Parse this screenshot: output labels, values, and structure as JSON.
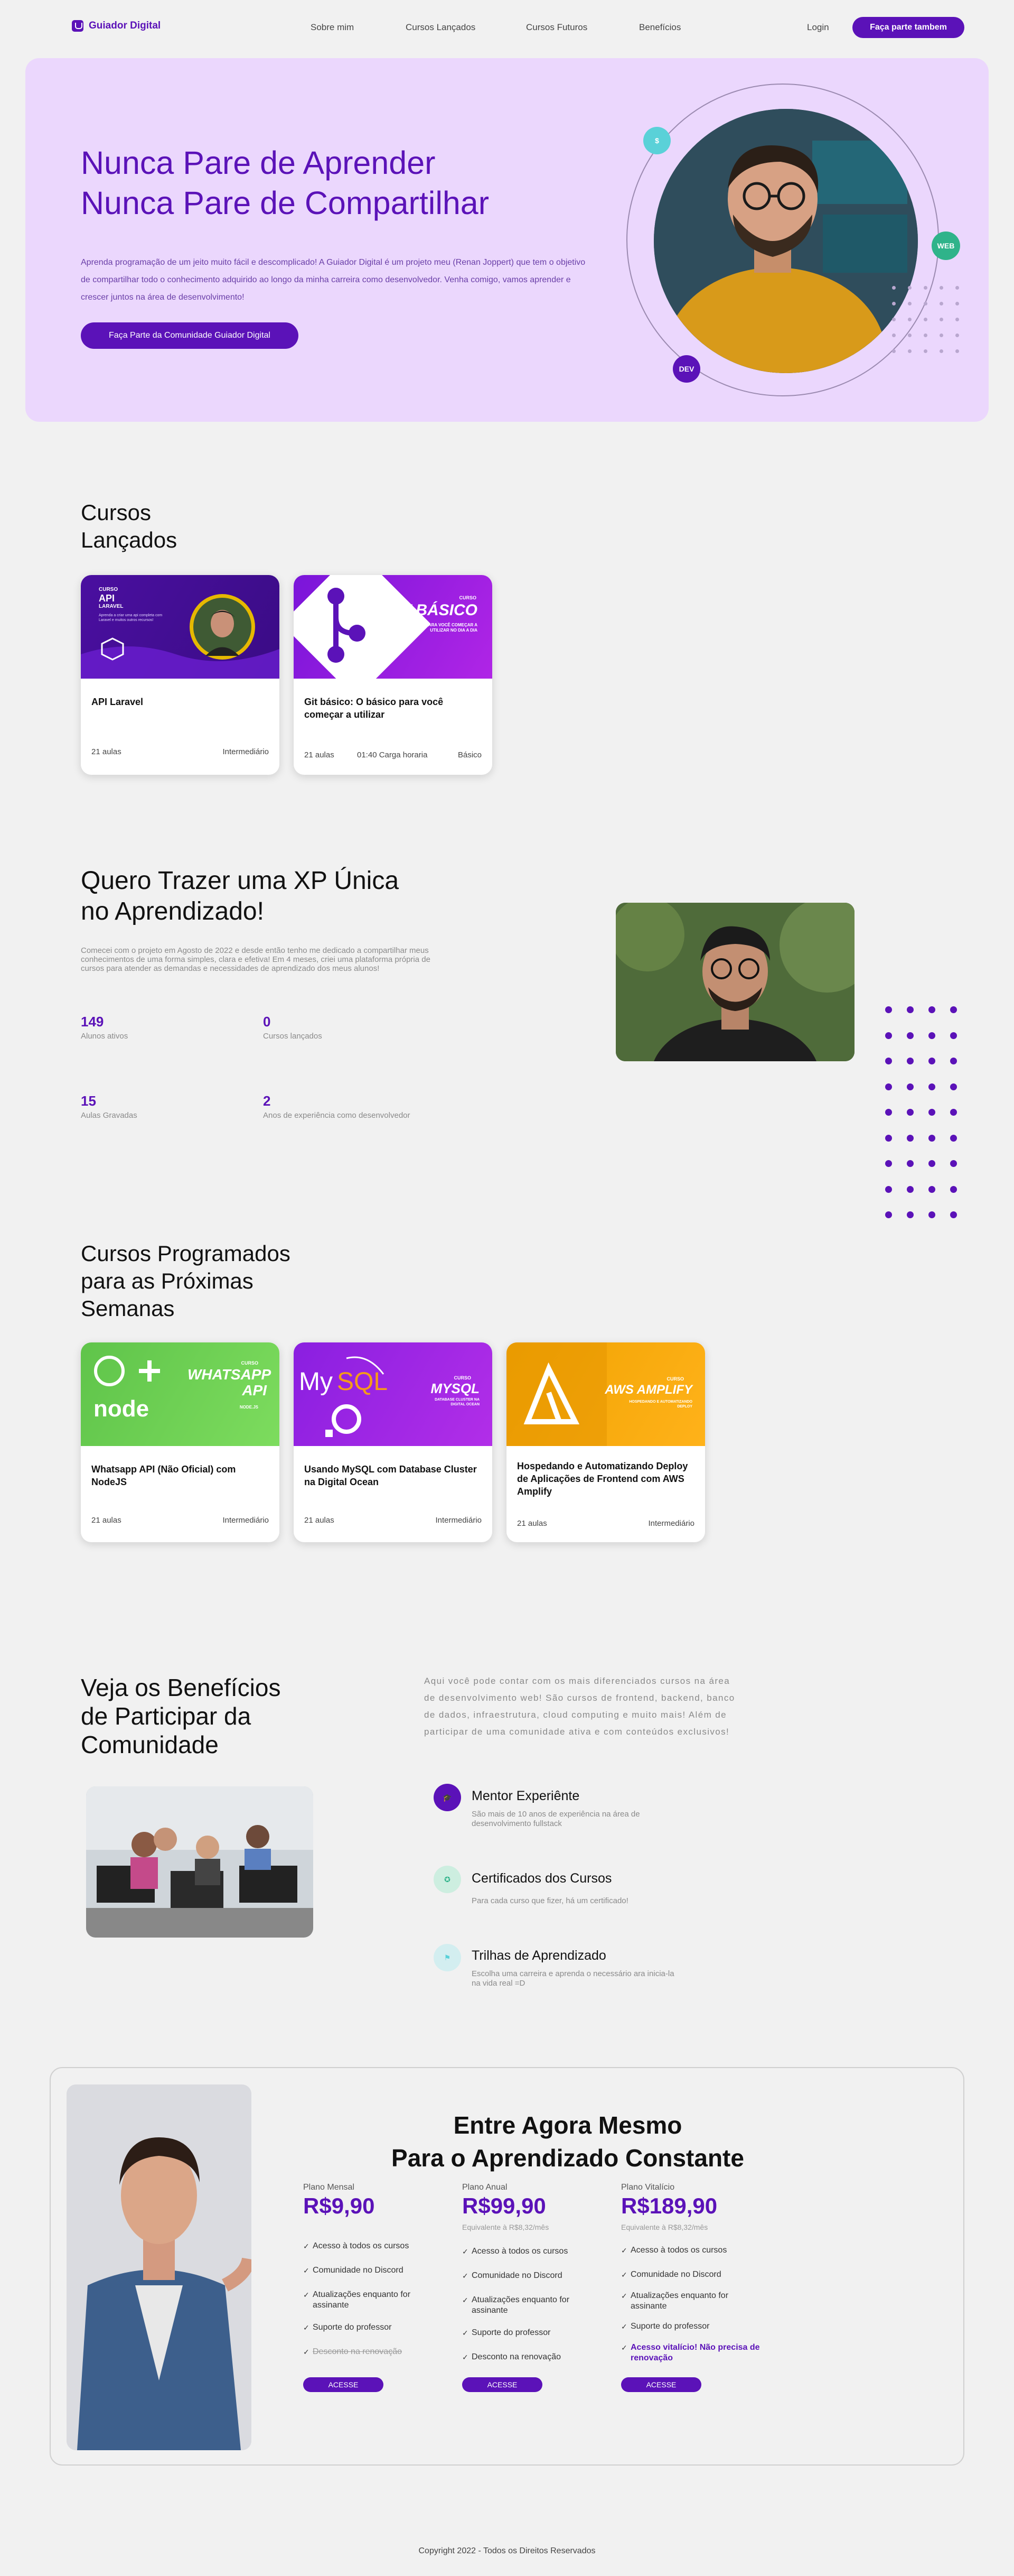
{
  "colors": {
    "brand": "#5b12b8",
    "hero_bg": "#ebd7fd",
    "teal": "#5ad1d8",
    "green": "#2fb38a",
    "light_bg": "#f1f1f1"
  },
  "nav": {
    "logo": "Guiador Digital",
    "links": [
      "Sobre mim",
      "Cursos Lançados",
      "Cursos Futuros",
      "Benefícios"
    ],
    "login": "Login",
    "cta": "Faça parte tambem"
  },
  "hero": {
    "title_line1": "Nunca Pare de Aprender",
    "title_line2": "Nunca Pare de Compartilhar",
    "text": "Aprenda programação de um jeito muito fácil e descomplicado! A Guiador Digital é um projeto meu (Renan Joppert) que tem o objetivo de compartilhar todo o conhecimento adquirido ao longo da minha carreira como desenvolvedor. Venha comigo, vamos aprender e crescer juntos na área de desenvolvimento!",
    "button": "Faça Parte da Comunidade Guiador Digital",
    "badges": [
      "$",
      "WEB",
      "DEV"
    ]
  },
  "launched": {
    "title_line1": "Cursos",
    "title_line2": "Lançados",
    "cards": [
      {
        "title": "API Laravel",
        "lessons": "21 aulas",
        "hours": "",
        "level": "Intermediário",
        "img_label_small": "CURSO",
        "img_label": "API",
        "img_label2": "LARAVEL",
        "img_caption": "Aprenda a criar uma api completa com Laravel e muitos outros recursos!"
      },
      {
        "title": "Git básico: O básico para você começar a utilizar",
        "lessons": "21 aulas",
        "hours": "01:40 Carga horaria",
        "level": "Básico",
        "img_label_small": "CURSO",
        "img_label": "GIT BÁSICO",
        "img_caption": "O BÁSICO PARA VOCÊ COMEÇAR A UTILIZAR NO DIA A DIA"
      }
    ]
  },
  "xp": {
    "title_line1": "Quero Trazer uma XP Única",
    "title_line2": "no Aprendizado!",
    "text": "Comecei com o projeto em Agosto de 2022 e desde então tenho me dedicado a compartilhar meus conhecimentos de uma forma simples, clara e efetiva! Em 4 meses, criei uma plataforma própria de cursos para atender as demandas e necessidades de aprendizado dos meus alunos!",
    "stats": [
      {
        "value": "149",
        "label": "Alunos ativos"
      },
      {
        "value": "0",
        "label": "Cursos lançados"
      },
      {
        "value": "15",
        "label": "Aulas Gravadas"
      },
      {
        "value": "2",
        "label": "Anos de experiência como desenvolvedor"
      }
    ]
  },
  "upcoming": {
    "title_line1": "Cursos Programados",
    "title_line2": "para as Próximas",
    "title_line3": "Semanas",
    "cards": [
      {
        "title": "Whatsapp API (Não Oficial) com NodeJS",
        "lessons": "21 aulas",
        "level": "Intermediário",
        "img_label": "WHATSAPP API",
        "img_small": "CURSO",
        "img_caption": "NODE.JS"
      },
      {
        "title": "Usando MySQL com Database Cluster na Digital Ocean",
        "lessons": "21 aulas",
        "level": "Intermediário",
        "img_label": "MYSQL",
        "img_small": "CURSO",
        "img_caption": "DATABASE CLUSTER NA DIGITAL OCEAN"
      },
      {
        "title": "Hospedando e Automatizando Deploy de Aplicações de Frontend com AWS Amplify",
        "lessons": "21 aulas",
        "level": "Intermediário",
        "img_label": "AWS AMPLIFY",
        "img_small": "CURSO",
        "img_caption": "HOSPEDANDO E AUTOMATIZANDO DEPLOY"
      }
    ]
  },
  "benefits": {
    "title_line1": "Veja os Benefícios",
    "title_line2": "de Participar da",
    "title_line3": "Comunidade",
    "intro": "Aqui você pode contar com os mais diferenciados cursos na área de desenvolvimento web! São cursos de frontend, backend, banco de dados, infraestrutura, cloud computing e muito mais! Além de participar de uma comunidade ativa e com conteúdos exclusivos!",
    "items": [
      {
        "title": "Mentor Experiênte",
        "desc": "São mais de 10 anos de experiência na área de desenvolvimento fullstack"
      },
      {
        "title": "Certificados dos Cursos",
        "desc": "Para cada curso que fizer, há um certificado!"
      },
      {
        "title": "Trilhas de Aprendizado",
        "desc": "Escolha uma carreira e aprenda o necessário ara inicia-la na vida real =D"
      }
    ]
  },
  "pricing": {
    "title_line1": "Entre Agora Mesmo",
    "title_line2": "Para o Aprendizado Constante",
    "plans": [
      {
        "name": "Plano Mensal",
        "price": "R$9,90",
        "sub": "",
        "features": [
          "Acesso à todos os cursos",
          "Comunidade no Discord",
          "Atualizações enquanto for assinante",
          "Suporte do professor",
          "Desconto na renovação"
        ],
        "button": "ACESSE"
      },
      {
        "name": "Plano Anual",
        "price": "R$99,90",
        "sub": "Equivalente à R$8,32/mês",
        "features": [
          "Acesso à todos os cursos",
          "Comunidade no Discord",
          "Atualizações enquanto for assinante",
          "Suporte do professor",
          "Desconto na renovação"
        ],
        "button": "ACESSE"
      },
      {
        "name": "Plano Vitalício",
        "price": "R$189,90",
        "sub": "Equivalente à R$8,32/mês",
        "features": [
          "Acesso à todos os cursos",
          "Comunidade no Discord",
          "Atualizações enquanto for assinante",
          "Suporte do professor",
          "Acesso vitalício! Não precisa de renovação"
        ],
        "button": "ACESSE"
      }
    ]
  },
  "footer": {
    "text": "Copyright 2022 - Todos os Direitos Reservados"
  }
}
